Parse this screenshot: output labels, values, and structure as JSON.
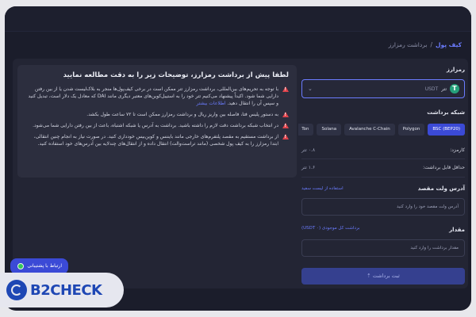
{
  "breadcrumb": {
    "wallet": "کیف پول",
    "sep": "/",
    "current": "برداشت رمزارز"
  },
  "notice": {
    "title": "لطفا پیش از برداشت رمزارز، توضیحات زیر را به دقت مطالعه نمایید",
    "items": [
      {
        "text": "با توجه به تحریم‌های بین‌المللی، برداشت رمزارز تتر ممکن است در برخی کیف‌پول‌ها منجر به بلاک‌لیست شدن یا از بین رفتن دارایی شما شود. اکیداً پیشنهاد می‌کنیم تتر خود را به استیبل‌کوین‌های معتبر دیگری مانند DAI که معادل یک دلار است، تبدیل کنید و سپس آن را انتقال دهید.",
        "link": "اطلاعات بیشتر"
      },
      {
        "text": "به دستور پلیس فتا، فاصله بین واریز ریال و برداشت رمزارز ممکن است تا ۷۲ ساعت طول بکشد.",
        "link": ""
      },
      {
        "text": "در انتخاب شبکه برداشت دقت لازم را داشته باشید. برداشت به آدرس یا شبکه اشتباه، باعث از بین رفتن دارایی شما می‌شود.",
        "link": ""
      },
      {
        "text": "از برداشت مستقیم به مقصد پلتفرم‌های خارجی مانند بایننس و کوین‌بیس خودداری کنید. در صورت نیاز به انجام چنین انتقالی، ابتدا رمزارز را به کیف پول شخصی (مانند تراست‌والت) انتقال داده و از انتقال‌های چندلایه بین آدرس‌های خود استفاده کنید.",
        "link": ""
      }
    ]
  },
  "form": {
    "currency_label": "رمزارز",
    "currency": {
      "name": "تتر",
      "code": "USDT",
      "icon_glyph": "T"
    },
    "network_label": "شبکه برداشت",
    "networks": [
      "BSC (BEP20)",
      "Polygon",
      "Avalanche C-Chain",
      "Solana",
      "Ton",
      "..."
    ],
    "active_network": "BSC (BEP20)",
    "fee_label": "کارمزد:",
    "fee_value": "۰.۸ تتر",
    "min_label": "حداقل قابل برداشت:",
    "min_value": "۱.۶ تتر",
    "address_label": "آدرس ولت مقصد",
    "address_link": "استفاده از لیست سفید",
    "address_placeholder": "آدرس ولت مقصد خود را وارد کنید",
    "amount_label": "مقدار",
    "amount_link": "برداشت کل موجودی (۰ USDT)",
    "amount_placeholder": "مقدار برداشت را وارد کنید",
    "submit": "ثبت برداشت"
  },
  "support": {
    "label": "ارتباط با پشتیبانی"
  },
  "logo": {
    "text": "B2CHECK"
  },
  "colors": {
    "accent": "#3b4ad6",
    "warning": "#e0444c",
    "background": "#1b1d2b"
  }
}
